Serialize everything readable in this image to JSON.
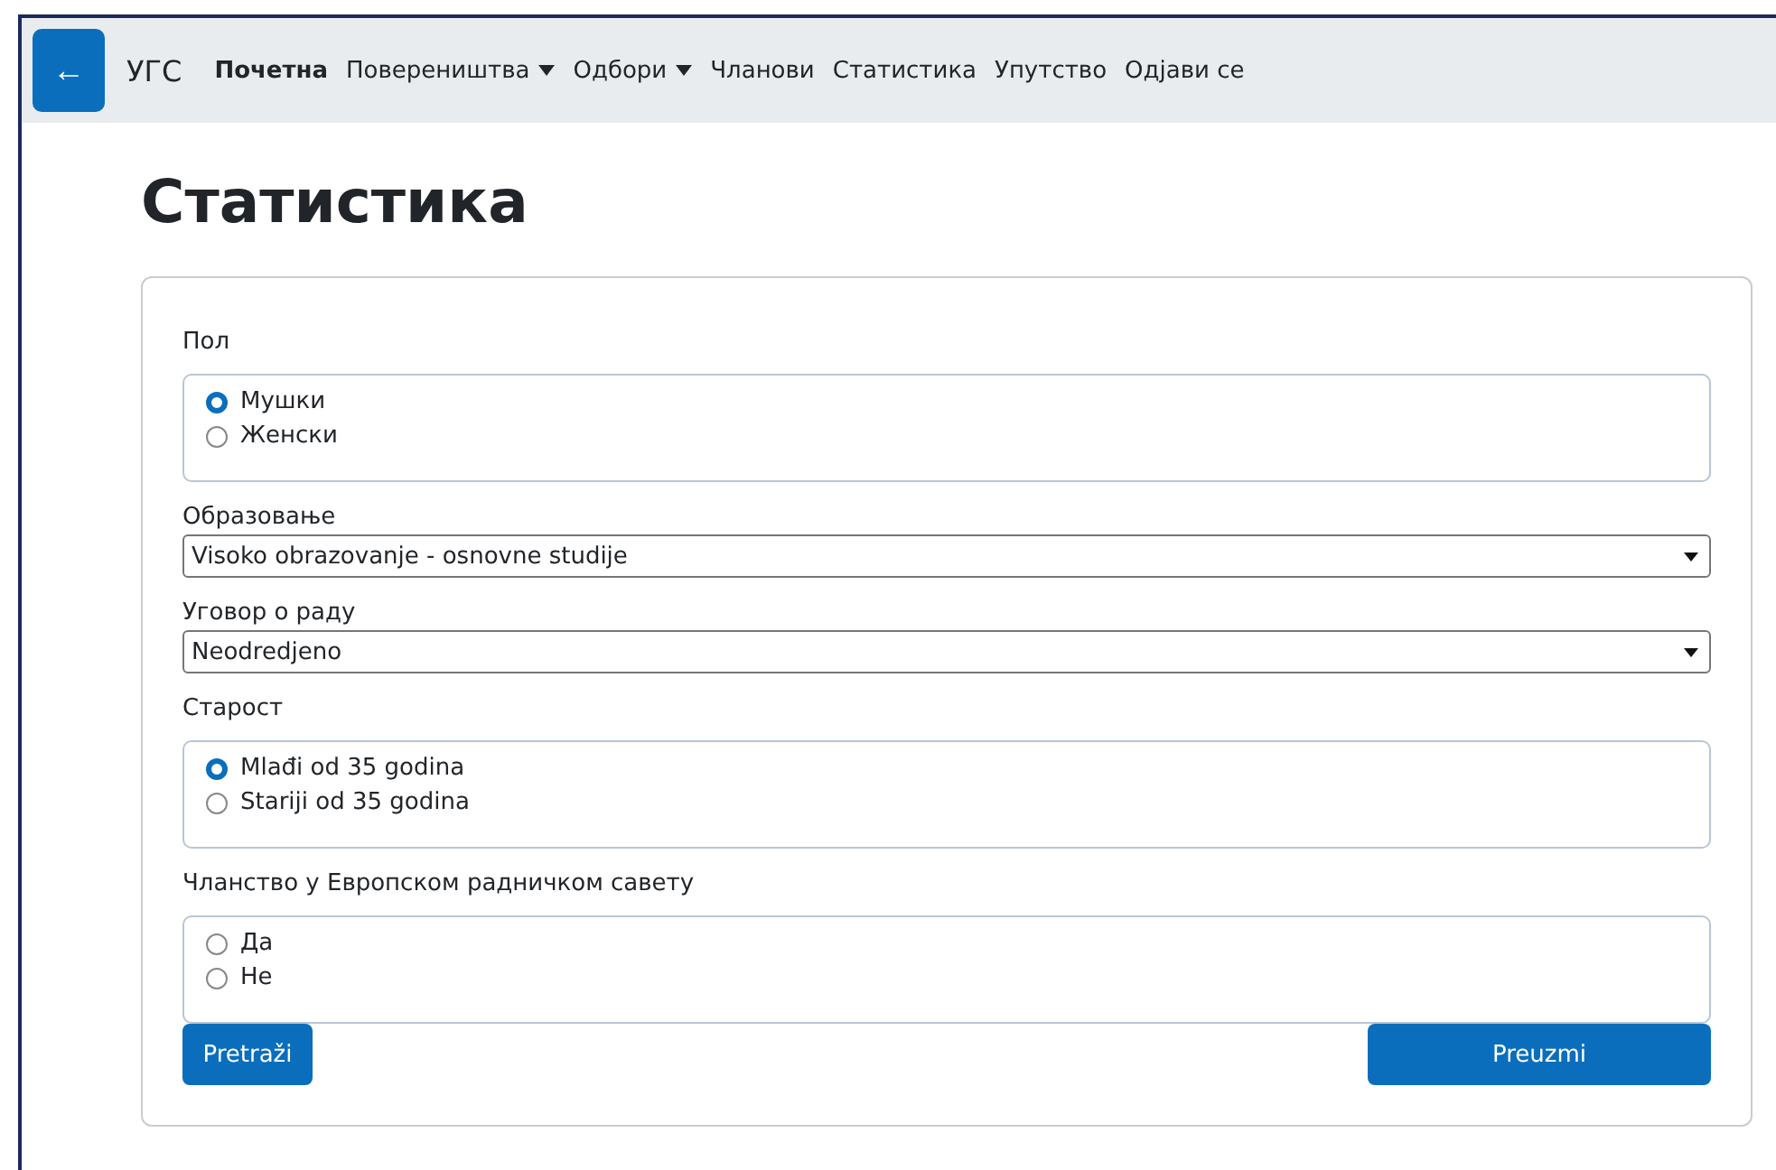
{
  "navbar": {
    "back_button": "←",
    "brand": "УГС",
    "items": [
      {
        "label": "Почетна",
        "selected": true,
        "dropdown": false
      },
      {
        "label": "Повереништва",
        "selected": false,
        "dropdown": true
      },
      {
        "label": "Одбори",
        "selected": false,
        "dropdown": true
      },
      {
        "label": "Чланови",
        "selected": false,
        "dropdown": false
      },
      {
        "label": "Статистика",
        "selected": false,
        "dropdown": false
      },
      {
        "label": "Упутство",
        "selected": false,
        "dropdown": false
      },
      {
        "label": "Одјави се",
        "selected": false,
        "dropdown": false
      }
    ]
  },
  "page_title": "Статистика",
  "fields": [
    {
      "kind": "radio",
      "label": "Пол",
      "options": [
        {
          "label": "Мушки",
          "selected": true
        },
        {
          "label": "Женски",
          "selected": false
        }
      ]
    },
    {
      "kind": "select",
      "label": "Образовање",
      "value": "Visoko obrazovanje - osnovne studije"
    },
    {
      "kind": "select",
      "label": "Уговор о раду",
      "value": "Neodredjeno"
    },
    {
      "kind": "radio",
      "label": "Старост",
      "options": [
        {
          "label": "Mlađi od 35 godina",
          "selected": true
        },
        {
          "label": "Stariji od 35 godina",
          "selected": false
        }
      ]
    },
    {
      "kind": "radio",
      "label": "Чланство у Европском радничком савету",
      "options": [
        {
          "label": "Да",
          "selected": false
        },
        {
          "label": "Не",
          "selected": false
        }
      ]
    }
  ],
  "buttons": [
    "Pretraži",
    "Preuzmi"
  ]
}
